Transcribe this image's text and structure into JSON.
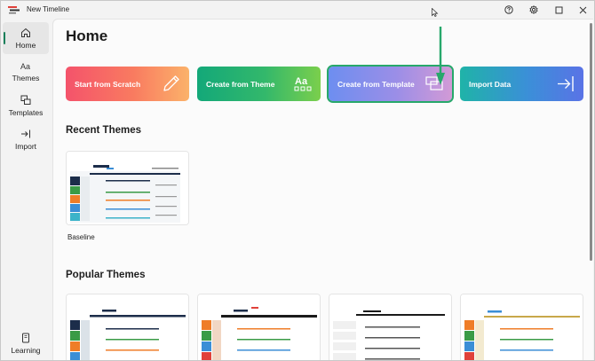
{
  "window": {
    "title": "New Timeline"
  },
  "titlebar": {
    "help_icon": "help-circle-icon",
    "settings_icon": "gear-icon",
    "maximize_icon": "maximize-icon",
    "close_icon": "close-icon"
  },
  "sidebar": {
    "items": [
      {
        "label": "Home",
        "icon": "home-icon",
        "active": true
      },
      {
        "label": "Themes",
        "icon": "font-aa-icon",
        "active": false
      },
      {
        "label": "Templates",
        "icon": "templates-icon",
        "active": false
      },
      {
        "label": "Import",
        "icon": "import-icon",
        "active": false
      },
      {
        "label": "Learning",
        "icon": "book-icon",
        "active": false
      }
    ]
  },
  "main": {
    "title": "Home",
    "actions": [
      {
        "label": "Start from Scratch",
        "icon": "pencil-icon"
      },
      {
        "label": "Create from Theme",
        "icon": "aa-grid-icon"
      },
      {
        "label": "Create from Template",
        "icon": "stacked-windows-icon"
      },
      {
        "label": "Import Data",
        "icon": "import-arrow-icon"
      }
    ],
    "recent_title": "Recent Themes",
    "recent_themes": [
      {
        "name": "Baseline"
      }
    ],
    "popular_title": "Popular Themes"
  },
  "colors": {
    "accent": "#1a7f5a",
    "annotation_arrow": "#27a86b",
    "timeline_dark": "#1c2d4a",
    "timeline_blue": "#3b8ed6",
    "timeline_orange": "#ef7d28",
    "timeline_green": "#3a9b46",
    "timeline_red": "#e0413a"
  }
}
